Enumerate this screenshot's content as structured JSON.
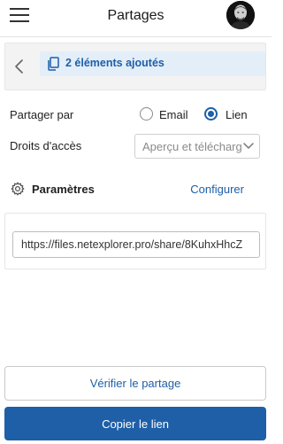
{
  "header": {
    "title": "Partages",
    "menu_icon": "hamburger-menu-icon",
    "avatar_icon": "user-avatar"
  },
  "summary": {
    "back_icon": "chevron-left-icon",
    "selection_icon": "copy-documents-icon",
    "selection_text": "2 éléments ajoutés"
  },
  "share": {
    "label": "Partager par",
    "options": [
      {
        "label": "Email",
        "checked": false
      },
      {
        "label": "Lien",
        "checked": true
      }
    ]
  },
  "rights": {
    "label": "Droits d'accès",
    "selected": "Aperçu et téléchargement",
    "chevron_icon": "chevron-down-icon"
  },
  "parameters": {
    "icon": "gear-icon",
    "label": "Paramètres",
    "action": "Configurer"
  },
  "link": {
    "value": "https://files.netexplorer.pro/share/8KuhxHhcZ"
  },
  "actions": {
    "verify": "Vérifier le partage",
    "copy": "Copier le lien"
  },
  "colors": {
    "accent": "#1e5fa8",
    "pill_bg": "#e3eef8",
    "panel_bg": "#f3f3f3"
  }
}
